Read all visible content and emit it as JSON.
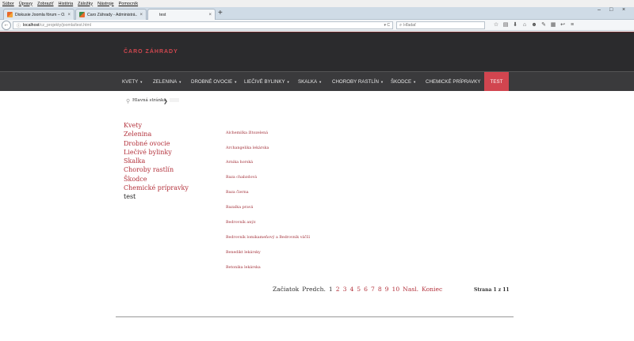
{
  "browser": {
    "menu": [
      "Súbor",
      "Úpravy",
      "Zobraziť",
      "História",
      "Záložky",
      "Nástroje",
      "Pomocník"
    ],
    "tabs": [
      {
        "title": "Diskusie Joomla fórum – O...",
        "close": "×"
      },
      {
        "title": "Čaro Záhrady - Administrá...",
        "close": "×"
      },
      {
        "title": "test",
        "close": "×"
      }
    ],
    "new_tab": "+",
    "window_controls": {
      "minimize": "–",
      "maximize": "□",
      "close": "×"
    },
    "back": "←",
    "url_host": "localhost",
    "url_path": "/cz_projekty/joomla/test.html",
    "url_tools": "▾ C",
    "search_placeholder": "Hľadať",
    "toolbar_icons": [
      "☆",
      "▤",
      "⬇",
      "⌂",
      "☻",
      "✎",
      "▦",
      "↩",
      "≡"
    ],
    "accent": "#d1454f"
  },
  "site": {
    "logo": "ČARO ZÁHRADY",
    "nav": [
      {
        "label": "Kvety",
        "caret": "▼"
      },
      {
        "label": "Zelenina",
        "caret": "▼"
      },
      {
        "label": "Drobné ovocie",
        "caret": "▼"
      },
      {
        "label": "Liečivé bylinky",
        "caret": "▼"
      },
      {
        "label": "Skalka",
        "caret": "▼"
      },
      {
        "label": "Choroby rastlín",
        "caret": "▼"
      },
      {
        "label": "Škodce",
        "caret": "▼"
      },
      {
        "label": "Chemické prípravky",
        "caret": ""
      },
      {
        "label": "Test",
        "caret": ""
      }
    ],
    "breadcrumb": {
      "home": "Hlavná stránka",
      "separator": "❯"
    },
    "side_menu": [
      "Kvety",
      "Zelenina",
      "Drobné ovocie",
      "Liečivé bylinky",
      "Skalka",
      "Choroby rastlín",
      "Škodce",
      "Chemické prípravky",
      "test"
    ],
    "articles": [
      "Alchemilka žltozelená",
      "Archangelika lekárska",
      "Arnika horská",
      "Baza chabzdová",
      "Baza čierna",
      "Bazalka pravá",
      "Bedrovník anýz",
      "Bedrovník lomikameňový a Bedrovník väčší",
      "Benedikt lekársky",
      "Betonika lekárska"
    ],
    "pagination": {
      "start": "Začiatok",
      "prev": "Predch.",
      "pages": [
        "1",
        "2",
        "3",
        "4",
        "5",
        "6",
        "7",
        "8",
        "9",
        "10"
      ],
      "next": "Nasl.",
      "end": "Koniec"
    },
    "page_counter": "Strana 1 z 11"
  }
}
